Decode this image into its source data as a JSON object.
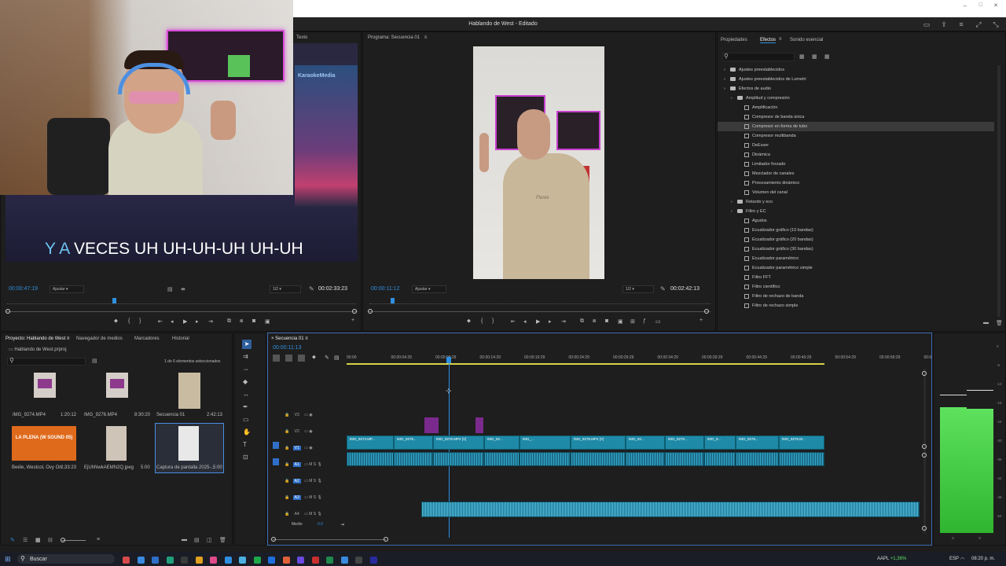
{
  "app": {
    "title": "Hablando de West - Editado"
  },
  "source_panel": {
    "tab": "Texto",
    "timecode": "00:00:47:19",
    "fit": "Ajustar",
    "res": "1/2",
    "duration": "00:02:33:23",
    "brand": "KaraokeMedia",
    "lyric_highlight": "Y A",
    "lyric_rest": "VECES UH UH-UH-UH UH-UH"
  },
  "program_panel": {
    "tab": "Programa: Secuencia 01",
    "timecode": "00:00:11:12",
    "fit": "Ajustar",
    "res": "1/2",
    "duration": "00:02:42:13",
    "sign": "TNT",
    "shirt": "Flores"
  },
  "effects_panel": {
    "tabs": [
      "Propiedades",
      "Efectos",
      "Sonido esencial"
    ],
    "items": [
      {
        "label": "Ajustes preestablecidos",
        "level": 0,
        "type": "folder"
      },
      {
        "label": "Ajustes preestablecidos de Lumetri",
        "level": 0,
        "type": "folder"
      },
      {
        "label": "Efectos de audio",
        "level": 0,
        "type": "folder"
      },
      {
        "label": "Amplitud y compresión",
        "level": 1,
        "type": "folder"
      },
      {
        "label": "Amplificación",
        "level": 2,
        "type": "fx"
      },
      {
        "label": "Compresor de banda única",
        "level": 2,
        "type": "fx"
      },
      {
        "label": "Compresor en forma de tubo",
        "level": 2,
        "type": "fx",
        "selected": true
      },
      {
        "label": "Compresor multibanda",
        "level": 2,
        "type": "fx"
      },
      {
        "label": "DeEsser",
        "level": 2,
        "type": "fx"
      },
      {
        "label": "Dinámica",
        "level": 2,
        "type": "fx"
      },
      {
        "label": "Limitador forzado",
        "level": 2,
        "type": "fx"
      },
      {
        "label": "Mezclador de canales",
        "level": 2,
        "type": "fx"
      },
      {
        "label": "Procesamiento dinámico",
        "level": 2,
        "type": "fx"
      },
      {
        "label": "Volumen del canal",
        "level": 2,
        "type": "fx"
      },
      {
        "label": "Retardo y eco",
        "level": 1,
        "type": "folder"
      },
      {
        "label": "Filtro y EC",
        "level": 1,
        "type": "folder"
      },
      {
        "label": "Agudos",
        "level": 2,
        "type": "fx"
      },
      {
        "label": "Ecualizador gráfico (10 bandas)",
        "level": 2,
        "type": "fx"
      },
      {
        "label": "Ecualizador gráfico (20 bandas)",
        "level": 2,
        "type": "fx"
      },
      {
        "label": "Ecualizador gráfico (30 bandas)",
        "level": 2,
        "type": "fx"
      },
      {
        "label": "Ecualizador paramétrico",
        "level": 2,
        "type": "fx"
      },
      {
        "label": "Ecualizador paramétrico simple",
        "level": 2,
        "type": "fx"
      },
      {
        "label": "Filtro FFT",
        "level": 2,
        "type": "fx"
      },
      {
        "label": "Filtro científico",
        "level": 2,
        "type": "fx"
      },
      {
        "label": "Filtro de rechazo de banda",
        "level": 2,
        "type": "fx"
      },
      {
        "label": "Filtro de rechazo simple",
        "level": 2,
        "type": "fx"
      }
    ]
  },
  "project_panel": {
    "tabs": [
      "Proyecto: Hablando de West",
      "Navegador de medios",
      "Marcadores",
      "Historial"
    ],
    "file": "Hablando de West.prproj",
    "selection": "1 de 6 elementos seleccionados",
    "items": [
      {
        "name": "IMG_9274.MP4",
        "dur": "1:20:12"
      },
      {
        "name": "IMG_9276.MP4",
        "dur": "8:30:20"
      },
      {
        "name": "Secuencia 01",
        "dur": "2:42:13"
      },
      {
        "name": "Beéle, Westcol, Ovy On...",
        "dur": "2:33:23",
        "thumb": "LA PLENA (W SOUND 05)"
      },
      {
        "name": "EjUhNwkAEMN2Q.jpeg",
        "dur": "5:00"
      },
      {
        "name": "Captura de pantalla 2025-...",
        "dur": "5:00"
      }
    ]
  },
  "timeline": {
    "tab": "Secuencia 01",
    "timecode": "00:00:11:13",
    "ruler": [
      "00:00",
      "00:00:04:29",
      "00:00:09:29",
      "00:00:14:29",
      "00:00:19:29",
      "00:00:24:29",
      "00:00:29:29",
      "00:00:34:29",
      "00:00:39:29",
      "00:00:44:29",
      "00:00:49:29",
      "00:00:54:29",
      "00:00:59:29",
      "00:0"
    ],
    "tracks": [
      "V3",
      "V2",
      "V1",
      "A1",
      "A2",
      "A3",
      "A4"
    ],
    "master": "Medio",
    "master_val": "0.0",
    "clips": [
      "IMG_9274.MP...",
      "IMG_9276...",
      "IMG_9276.MP4 [V]",
      "IMG_92...",
      "IMG_...",
      "IMG_9276.MP4 [V]",
      "IMG_92...",
      "IMG_9276...",
      "IMG_9...",
      "IMG_9276...",
      "IMG_9276.M..."
    ]
  },
  "audio_meter": {
    "scale": [
      "0",
      "-6",
      "-12",
      "-18",
      "-24",
      "-30",
      "-36",
      "-42",
      "-48",
      "-54"
    ],
    "foot": [
      "S",
      "S"
    ]
  },
  "taskbar": {
    "search": "Buscar",
    "ticker": "AAPL",
    "change": "+1,36%",
    "lang": "ESP",
    "time": "08:20 p. m."
  }
}
